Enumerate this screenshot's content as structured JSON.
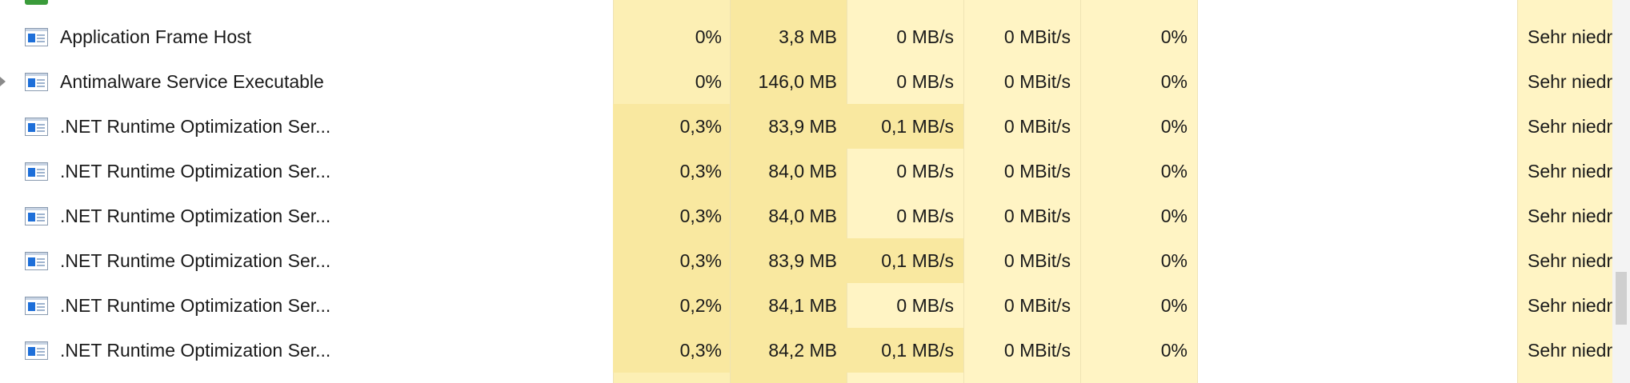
{
  "colors": {
    "cell_light": "#fff4c4",
    "cell_medium": "#fcefb4",
    "cell_dark": "#f9e8a0",
    "app_icon_blue": "#1e6fd9"
  },
  "rows": [
    {
      "name": "Application Frame Host",
      "cpu": "0%",
      "memory": "3,8 MB",
      "disk": "0 MB/s",
      "network": "0 MBit/s",
      "gpu": "0%",
      "priority": "Sehr niedri",
      "expandable": false
    },
    {
      "name": "Antimalware Service Executable",
      "cpu": "0%",
      "memory": "146,0 MB",
      "disk": "0 MB/s",
      "network": "0 MBit/s",
      "gpu": "0%",
      "priority": "Sehr niedri",
      "expandable": true
    },
    {
      "name": ".NET Runtime Optimization Ser...",
      "cpu": "0,3%",
      "memory": "83,9 MB",
      "disk": "0,1 MB/s",
      "network": "0 MBit/s",
      "gpu": "0%",
      "priority": "Sehr niedri",
      "expandable": false
    },
    {
      "name": ".NET Runtime Optimization Ser...",
      "cpu": "0,3%",
      "memory": "84,0 MB",
      "disk": "0 MB/s",
      "network": "0 MBit/s",
      "gpu": "0%",
      "priority": "Sehr niedri",
      "expandable": false
    },
    {
      "name": ".NET Runtime Optimization Ser...",
      "cpu": "0,3%",
      "memory": "84,0 MB",
      "disk": "0 MB/s",
      "network": "0 MBit/s",
      "gpu": "0%",
      "priority": "Sehr niedri",
      "expandable": false
    },
    {
      "name": ".NET Runtime Optimization Ser...",
      "cpu": "0,3%",
      "memory": "83,9 MB",
      "disk": "0,1 MB/s",
      "network": "0 MBit/s",
      "gpu": "0%",
      "priority": "Sehr niedri",
      "expandable": false
    },
    {
      "name": ".NET Runtime Optimization Ser...",
      "cpu": "0,2%",
      "memory": "84,1 MB",
      "disk": "0 MB/s",
      "network": "0 MBit/s",
      "gpu": "0%",
      "priority": "Sehr niedri",
      "expandable": false
    },
    {
      "name": ".NET Runtime Optimization Ser...",
      "cpu": "0,3%",
      "memory": "84,2 MB",
      "disk": "0,1 MB/s",
      "network": "0 MBit/s",
      "gpu": "0%",
      "priority": "Sehr niedri",
      "expandable": false
    }
  ]
}
